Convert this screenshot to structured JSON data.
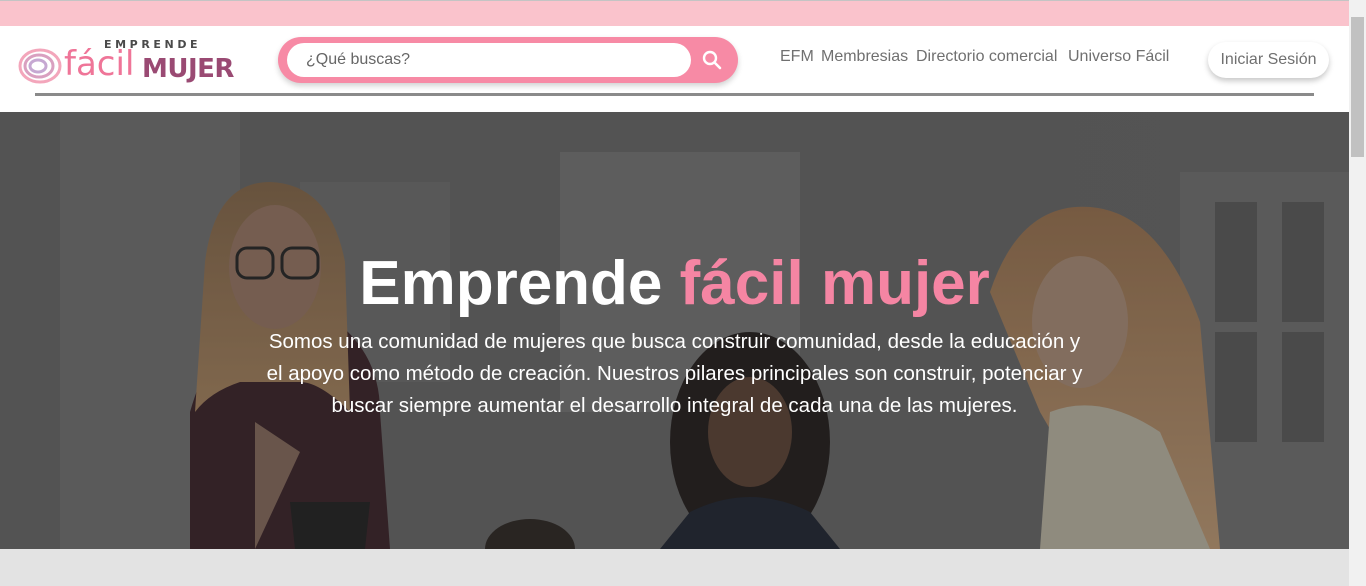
{
  "header": {
    "logo": {
      "top_word": "EMPRENDE",
      "word_facil": "fácil",
      "word_mujer": "MUJER"
    },
    "search": {
      "placeholder": "¿Qué buscas?",
      "icon": "search-icon"
    },
    "nav": [
      {
        "label": "EFM"
      },
      {
        "label": "Membresias"
      },
      {
        "label": "Directorio comercial"
      },
      {
        "label": "Universo Fácil"
      }
    ],
    "login_label": "Iniciar Sesión"
  },
  "hero": {
    "title_plain": "Emprende",
    "title_accent": "fácil mujer",
    "description": "Somos una comunidad de mujeres que busca construir comunidad, desde la educación y el apoyo como método de creación. Nuestros pilares principales son construir, potenciar y buscar siempre aumentar el desarrollo integral de cada una de las mujeres."
  },
  "colors": {
    "top_strip": "#fac3cc",
    "brand_pink": "#f78aa5",
    "title_accent": "#f585a3",
    "logo_mujer": "#9a4a73"
  }
}
